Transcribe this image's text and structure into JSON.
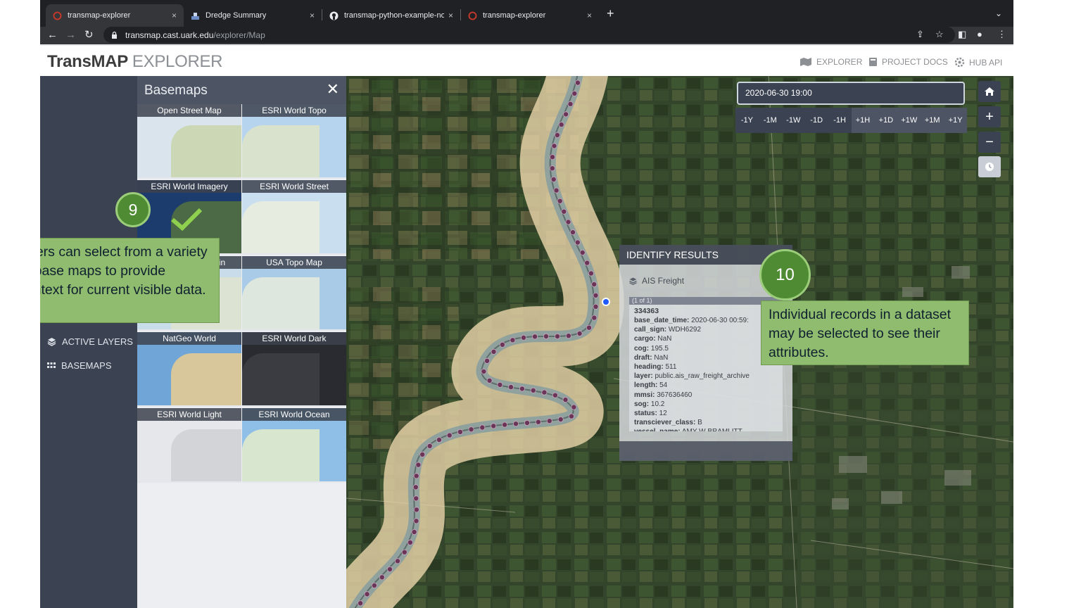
{
  "browser": {
    "tabs": [
      {
        "title": "transmap-explorer",
        "icon": "transmap-favicon",
        "active": true
      },
      {
        "title": "Dredge Summary",
        "icon": "dredge-favicon",
        "active": false
      },
      {
        "title": "transmap-python-example-no",
        "icon": "github-icon",
        "active": false
      },
      {
        "title": "transmap-explorer",
        "icon": "transmap-favicon",
        "active": false
      }
    ],
    "tab_close": "×",
    "new_tab": "+",
    "url_host": "transmap.cast.uark.edu",
    "url_path": "/explorer/Map"
  },
  "header": {
    "brand_main": "TransMAP",
    "brand_sub": "EXPLORER",
    "nav": [
      {
        "label": "EXPLORER",
        "icon": "map-icon"
      },
      {
        "label": "PROJECT DOCS",
        "icon": "book-icon"
      },
      {
        "label": "HUB API",
        "icon": "cog-icon"
      }
    ]
  },
  "sidebar": {
    "items": [
      {
        "label": "ACTIVE LAYERS",
        "icon": "layers-icon"
      },
      {
        "label": "BASEMAPS",
        "icon": "grid-icon"
      }
    ]
  },
  "basemaps": {
    "title": "Basemaps",
    "close": "✕",
    "items": [
      {
        "label": "Open Street Map",
        "style": "street",
        "selected": false
      },
      {
        "label": "ESRI World Topo",
        "style": "topo",
        "selected": false
      },
      {
        "label": "ESRI World Imagery",
        "style": "imagery",
        "selected": true
      },
      {
        "label": "ESRI World Street",
        "style": "street2",
        "selected": false
      },
      {
        "label": "ESRI World Terrain",
        "style": "terrain",
        "selected": false
      },
      {
        "label": "USA Topo Map",
        "style": "usatopo",
        "selected": false
      },
      {
        "label": "NatGeo World",
        "style": "natgeo",
        "selected": false
      },
      {
        "label": "ESRI World Dark",
        "style": "dark",
        "selected": false
      },
      {
        "label": "ESRI World Light",
        "style": "light",
        "selected": false
      },
      {
        "label": "ESRI World Ocean",
        "style": "ocean",
        "selected": false
      }
    ]
  },
  "time_control": {
    "datetime": "2020-06-30 19:00",
    "back_steps": [
      "-1Y",
      "-1M",
      "-1W",
      "-1D",
      "-1H"
    ],
    "forward_steps": [
      "+1H",
      "+1D",
      "+1W",
      "+1M",
      "+1Y"
    ]
  },
  "map_buttons": {
    "home": "home-icon",
    "zoom_in": "+",
    "zoom_out": "−",
    "time": "clock-icon"
  },
  "identify": {
    "title": "IDENTIFY RESULTS",
    "layer": "AIS Freight",
    "count": "(1 of 1)",
    "record_id": "334363",
    "fields": [
      {
        "k": "base_date_time:",
        "v": "2020-06-30 00:59:"
      },
      {
        "k": "call_sign:",
        "v": "WDH6292"
      },
      {
        "k": "cargo:",
        "v": "NaN"
      },
      {
        "k": "cog:",
        "v": "195.5"
      },
      {
        "k": "draft:",
        "v": "NaN"
      },
      {
        "k": "heading:",
        "v": "511"
      },
      {
        "k": "layer:",
        "v": "public.ais_raw_freight_archive"
      },
      {
        "k": "length:",
        "v": "54"
      },
      {
        "k": "mmsi:",
        "v": "367636460"
      },
      {
        "k": "sog:",
        "v": "10.2"
      },
      {
        "k": "status:",
        "v": "12"
      },
      {
        "k": "transciever_class:",
        "v": "B"
      },
      {
        "k": "vessel_name:",
        "v": "AMY W BRAMLITT"
      }
    ]
  },
  "annotations": {
    "num9": "9",
    "text9": "Users can select from a variety of base maps to provide context for current visible data.",
    "num10": "10",
    "text10": "Individual records in a dataset may be selected to see their attributes."
  },
  "colors": {
    "sidebar": "#3b4352",
    "panel_header": "#4d5564",
    "annotation_fill": "#8fbc6e",
    "annotation_circle": "#4e8b32",
    "river_buffer": "#e6d3a8",
    "ais_point": "#6b3558",
    "selected_point": "#1e5bff"
  }
}
